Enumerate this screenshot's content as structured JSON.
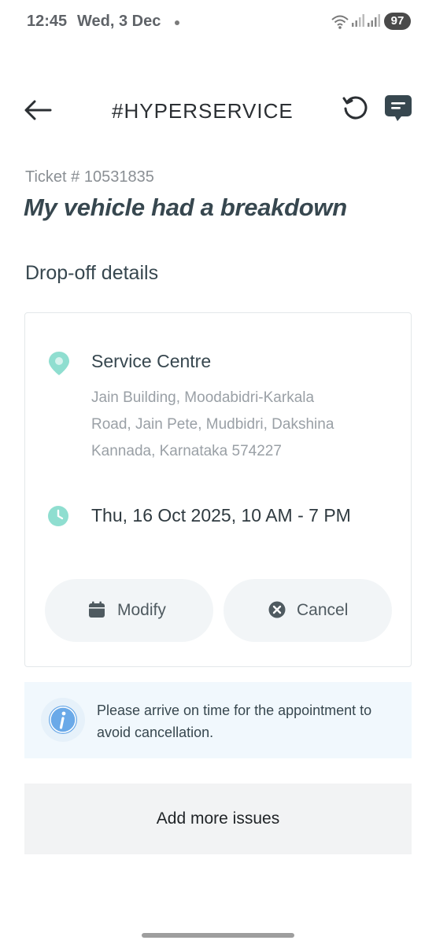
{
  "status_bar": {
    "time": "12:45",
    "date": "Wed, 3 Dec",
    "battery": "97"
  },
  "header": {
    "title": "#HYPERSERVICE"
  },
  "ticket": {
    "label": "Ticket # 10531835",
    "title": "My vehicle had a breakdown"
  },
  "dropoff": {
    "section_title": "Drop-off details",
    "centre_name": "Service Centre",
    "address": "Jain Building, Moodabidri-Karkala Road, Jain Pete, Mudbidri, Dakshina Kannada, Karnataka 574227",
    "slot": "Thu, 16 Oct 2025, 10 AM - 7 PM",
    "modify_label": "Modify",
    "cancel_label": "Cancel"
  },
  "info": {
    "text": "Please arrive on time for the appointment to avoid cancellation."
  },
  "actions": {
    "add_issues_label": "Add more issues"
  },
  "colors": {
    "accent_teal": "#7fd3c4",
    "info_blue": "#6aa9e8",
    "text_dark": "#37474f",
    "text_muted": "#9aa0a6"
  }
}
